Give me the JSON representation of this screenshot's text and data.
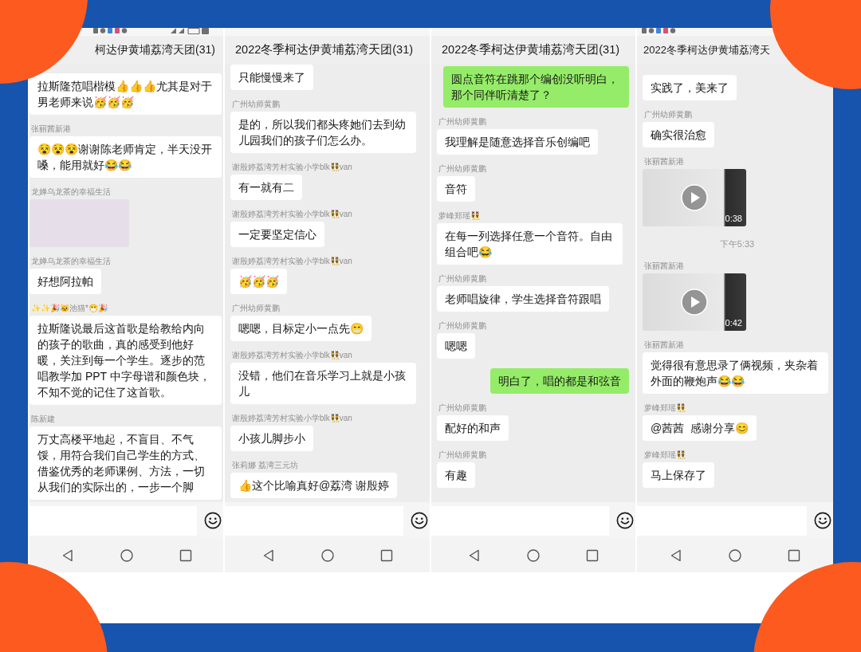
{
  "panels": [
    {
      "title": "柯达伊黄埔荔湾天团(31)",
      "status_icons": {
        "left": true,
        "right": true
      },
      "messages": [
        {
          "kind": "received",
          "text": "拉斯隆范唱楷模👍👍👍尤其是对于男老师来说🥳🥳🥳"
        },
        {
          "kind": "received",
          "sender": "张丽茜新港",
          "text": "😵😵😵谢谢陈老师肯定，半天没开嗓，能用就好😂😂"
        },
        {
          "kind": "photo",
          "sender": "龙婵乌龙茶的幸福生活"
        },
        {
          "kind": "received",
          "sender": "龙婵乌龙茶的幸福生活",
          "text": "好想阿拉帕"
        },
        {
          "kind": "received",
          "sender": "✨✨🎉🐱池猫*😷🎉",
          "text": "拉斯隆说最后这首歌是给教给内向的孩子的歌曲，真的感受到他好暖，关注到每一个学生。逐步的范唱教学加 PPT 中字母谱和颜色块，不知不觉的记住了这首歌。"
        },
        {
          "kind": "received",
          "sender": "陈新建",
          "text": "万丈高楼平地起，不盲目、不气馁，用符合我们自己学生的方式、借鉴优秀的老师课例、方法，一切从我们的实际出的，一步一个脚"
        }
      ]
    },
    {
      "title": "2022冬季柯达伊黄埔荔湾天团(31)",
      "messages": [
        {
          "kind": "received",
          "text": "只能慢慢来了"
        },
        {
          "kind": "received",
          "sender": "广州幼师黄鹏",
          "text": "是的，所以我们都头疼她们去到幼儿园我们的孩子们怎么办。"
        },
        {
          "kind": "received",
          "sender": "谢殷婷荔湾芳村实验小学blk👯van",
          "text": "有一就有二"
        },
        {
          "kind": "received",
          "sender": "谢殷婷荔湾芳村实验小学blk👯van",
          "text": "一定要坚定信心"
        },
        {
          "kind": "received",
          "sender": "谢殷婷荔湾芳村实验小学blk👯van",
          "text": "🥳🥳🥳"
        },
        {
          "kind": "received",
          "sender": "广州幼师黄鹏",
          "text": "嗯嗯，目标定小一点先😁"
        },
        {
          "kind": "received",
          "sender": "谢殷婷荔湾芳村实验小学blk👯van",
          "text": "没错，他们在音乐学习上就是小孩儿"
        },
        {
          "kind": "received",
          "sender": "谢殷婷荔湾芳村实验小学blk👯van",
          "text": "小孩儿脚步小"
        },
        {
          "kind": "received",
          "sender": "张莉娜 荔湾三元坊",
          "text": "👍这个比喻真好@荔湾 谢殷婷"
        }
      ]
    },
    {
      "title": "2022冬季柯达伊黄埔荔湾天团(31)",
      "messages": [
        {
          "kind": "sent",
          "text": "圆点音符在跳那个编创没听明白，那个同伴听清楚了？"
        },
        {
          "kind": "received",
          "sender": "广州幼师黄鹏",
          "text": "我理解是随意选择音乐创编吧"
        },
        {
          "kind": "received",
          "sender": "广州幼师黄鹏",
          "text": "音符"
        },
        {
          "kind": "received",
          "sender": "萝峰郑瑶👯",
          "text": "在每一列选择任意一个音符。自由组合吧😂"
        },
        {
          "kind": "received",
          "sender": "广州幼师黄鹏",
          "text": "老师唱旋律，学生选择音符跟唱"
        },
        {
          "kind": "received",
          "sender": "广州幼师黄鹏",
          "text": "嗯嗯"
        },
        {
          "kind": "sent",
          "text": "明白了，唱的都是和弦音"
        },
        {
          "kind": "received",
          "sender": "广州幼师黄鹏",
          "text": "配好的和声"
        },
        {
          "kind": "received",
          "sender": "广州幼师黄鹏",
          "text": "有趣"
        }
      ]
    },
    {
      "title": "2022冬季柯达伊黄埔荔湾天",
      "status_icons": {
        "left": true,
        "right": false
      },
      "messages": [
        {
          "kind": "received",
          "text": "实践了，美来了"
        },
        {
          "kind": "received",
          "sender": "广州幼师黄鹏",
          "text": "确实很治愈"
        },
        {
          "kind": "video",
          "sender": "张丽茜新港",
          "duration": "0:38"
        },
        {
          "kind": "time",
          "text": "下午5:33"
        },
        {
          "kind": "video",
          "sender": "张丽茜新港",
          "duration": "0:42"
        },
        {
          "kind": "received",
          "sender": "张丽茜新港",
          "text": "觉得很有意思录了俩视频，夹杂着外面的鞭炮声😂😂"
        },
        {
          "kind": "received",
          "sender": "萝峰郑瑶👯",
          "text": "@茜茜  感谢分享😊"
        },
        {
          "kind": "received",
          "sender": "萝峰郑瑶👯",
          "text": "马上保存了"
        }
      ]
    }
  ]
}
